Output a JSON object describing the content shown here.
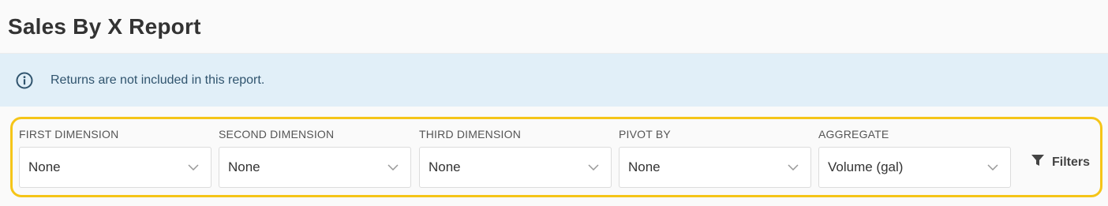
{
  "page": {
    "title": "Sales By X Report"
  },
  "banner": {
    "icon": "info-circle-icon",
    "message": "Returns are not included in this report.",
    "background": "#e1eff8",
    "text_color": "#30546e"
  },
  "filters_panel": {
    "highlight_color": "#f5c518",
    "fields": [
      {
        "label": "FIRST DIMENSION",
        "value": "None"
      },
      {
        "label": "SECOND DIMENSION",
        "value": "None"
      },
      {
        "label": "THIRD DIMENSION",
        "value": "None"
      },
      {
        "label": "PIVOT BY",
        "value": "None"
      },
      {
        "label": "AGGREGATE",
        "value": "Volume (gal)"
      }
    ],
    "filters_button": {
      "icon": "funnel-icon",
      "label": "Filters"
    }
  }
}
